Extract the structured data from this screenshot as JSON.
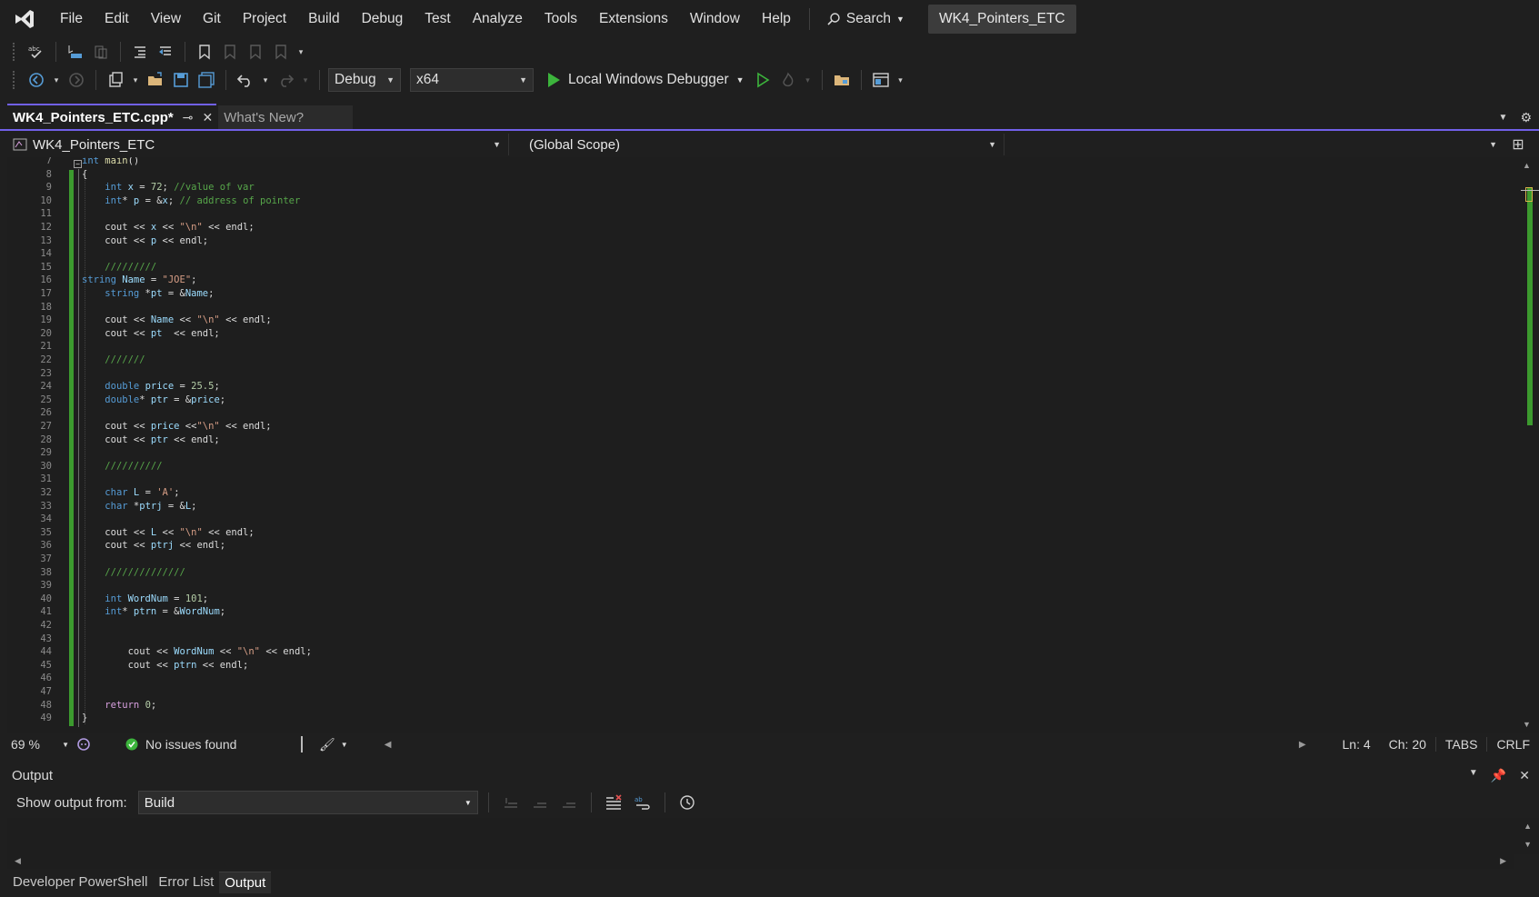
{
  "menubar": {
    "items": [
      "File",
      "Edit",
      "View",
      "Git",
      "Project",
      "Build",
      "Debug",
      "Test",
      "Analyze",
      "Tools",
      "Extensions",
      "Window",
      "Help"
    ],
    "search_label": "Search",
    "solution_name": "WK4_Pointers_ETC"
  },
  "toolbar": {
    "configuration": "Debug",
    "platform": "x64",
    "debugger_label": "Local Windows Debugger"
  },
  "tabs": {
    "active": "WK4_Pointers_ETC.cpp*",
    "inactive": "What's New?"
  },
  "navbar": {
    "project": "WK4_Pointers_ETC",
    "scope": "(Global Scope)"
  },
  "editor": {
    "line_numbers": [
      "7",
      "8",
      "9",
      "10",
      "11",
      "12",
      "13",
      "14",
      "15",
      "16",
      "17",
      "18",
      "19",
      "20",
      "21",
      "22",
      "23",
      "24",
      "25",
      "26",
      "27",
      "28",
      "29",
      "30",
      "31",
      "32",
      "33",
      "34",
      "35",
      "36",
      "37",
      "38",
      "39",
      "40",
      "41",
      "42",
      "43",
      "44",
      "45",
      "46",
      "47",
      "48",
      "49"
    ],
    "lines": [
      "int main()",
      "{",
      "    int x = 72; //value of var",
      "    int* p = &x; // address of pointer",
      "",
      "    cout << x << \"\\n\" << endl;",
      "    cout << p << endl;",
      "",
      "    /////////",
      "string Name = \"JOE\";",
      "    string *pt = &Name;",
      "",
      "    cout << Name << \"\\n\" << endl;",
      "    cout << pt  << endl;",
      "",
      "    ///////",
      "",
      "    double price = 25.5;",
      "    double* ptr = &price;",
      "",
      "    cout << price <<\"\\n\" << endl;",
      "    cout << ptr << endl;",
      "",
      "    //////////",
      "",
      "    char L = 'A';",
      "    char *ptrj = &L;",
      "",
      "    cout << L << \"\\n\" << endl;",
      "    cout << ptrj << endl;",
      "",
      "    //////////////",
      "",
      "    int WordNum = 101;",
      "    int* ptrn = &WordNum;",
      "",
      "",
      "        cout << WordNum << \"\\n\" << endl;",
      "        cout << ptrn << endl;",
      "",
      "",
      "    return 0;",
      "}"
    ]
  },
  "status": {
    "zoom": "69 %",
    "health": "No issues found",
    "line": "Ln: 4",
    "char": "Ch: 20",
    "indent": "TABS",
    "eol": "CRLF"
  },
  "output": {
    "title": "Output",
    "show_from_label": "Show output from:",
    "source": "Build"
  },
  "bottom_tabs": [
    "Developer PowerShell",
    "Error List",
    "Output"
  ],
  "colors": {
    "accent": "#7160e8",
    "change_bar": "#3c9a2e",
    "keyword": "#569cd6",
    "comment": "#57a64a",
    "string": "#d69d85"
  }
}
